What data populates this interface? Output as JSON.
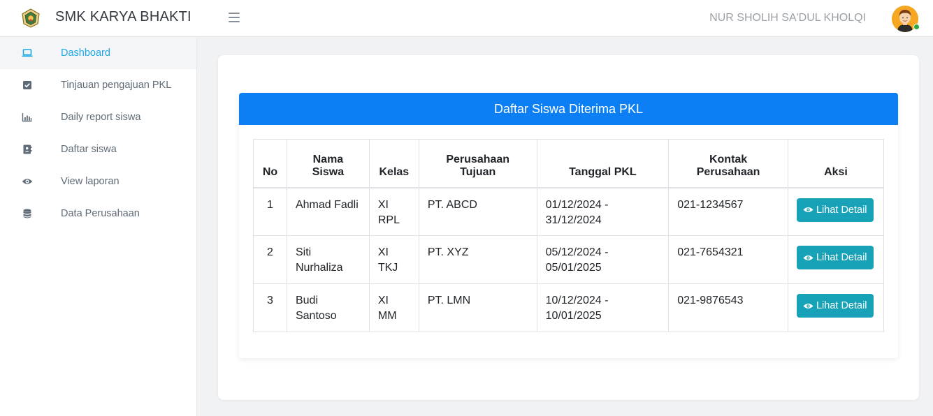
{
  "app": {
    "brand": "SMK KARYA BHAKTI",
    "username": "NUR SHOLIH SA'DUL KHOLQI"
  },
  "sidebar": {
    "items": [
      {
        "label": "Dashboard",
        "icon": "laptop-icon",
        "active": true
      },
      {
        "label": "Tinjauan pengajuan PKL",
        "icon": "check-square-icon"
      },
      {
        "label": "Daily report siswa",
        "icon": "bar-chart-icon"
      },
      {
        "label": "Daftar siswa",
        "icon": "address-book-icon"
      },
      {
        "label": "View laporan",
        "icon": "eye-icon"
      },
      {
        "label": "Data Perusahaan",
        "icon": "database-icon"
      }
    ]
  },
  "panel": {
    "title": "Daftar Siswa Diterima PKL"
  },
  "table": {
    "headers": {
      "no": "No",
      "nama_1": "Nama",
      "nama_2": "Siswa",
      "kelas": "Kelas",
      "perusahaan_1": "Perusahaan",
      "perusahaan_2": "Tujuan",
      "tanggal": "Tanggal PKL",
      "kontak_1": "Kontak",
      "kontak_2": "Perusahaan",
      "aksi": "Aksi"
    },
    "rows": [
      {
        "no": "1",
        "nama": "Ahmad Fadli",
        "kelas": "XI RPL",
        "perusahaan": "PT. ABCD",
        "tanggal_1": "01/12/2024 -",
        "tanggal_2": "31/12/2024",
        "kontak": "021-1234567",
        "aksi": "Lihat Detail"
      },
      {
        "no": "2",
        "nama": "Siti Nurhaliza",
        "kelas": "XI TKJ",
        "perusahaan": "PT. XYZ",
        "tanggal_1": "05/12/2024 -",
        "tanggal_2": "05/01/2025",
        "kontak": "021-7654321",
        "aksi": "Lihat Detail"
      },
      {
        "no": "3",
        "nama": "Budi Santoso",
        "kelas": "XI MM",
        "perusahaan": "PT. LMN",
        "tanggal_1": "10/12/2024 -",
        "tanggal_2": "10/01/2025",
        "kontak": "021-9876543",
        "aksi": "Lihat Detail"
      }
    ]
  },
  "colors": {
    "accent": "#0d7ff5",
    "button": "#17a2b8",
    "active_nav": "#1ea7e1",
    "online": "#28a745"
  }
}
